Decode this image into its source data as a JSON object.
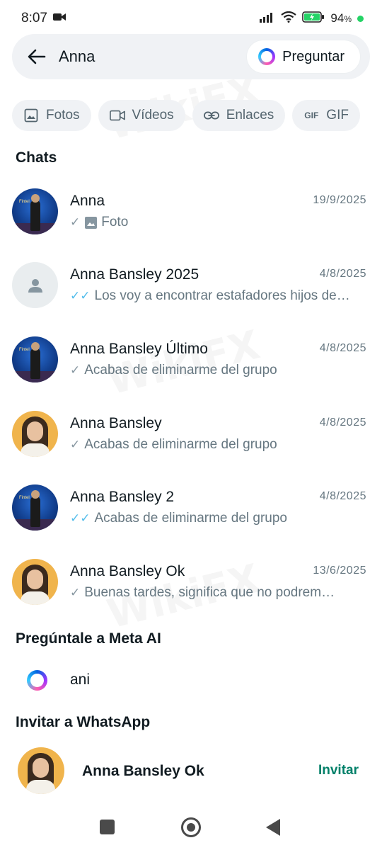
{
  "status_bar": {
    "time": "8:07",
    "battery": "94",
    "battery_unit": "%"
  },
  "search": {
    "query": "Anna",
    "ask_label": "Preguntar"
  },
  "filters": [
    {
      "label": "Fotos",
      "icon": "image-icon"
    },
    {
      "label": "Vídeos",
      "icon": "video-icon"
    },
    {
      "label": "Enlaces",
      "icon": "link-icon"
    },
    {
      "label": "GIF",
      "icon": "gif-icon"
    }
  ],
  "sections": {
    "chats": "Chats",
    "meta_ai": "Pregúntale a Meta AI",
    "invite": "Invitar a WhatsApp"
  },
  "chats": [
    {
      "name": "Anna",
      "date": "19/9/2025",
      "preview": "Foto",
      "tick": "✓",
      "status": "sent",
      "avatar": "stage"
    },
    {
      "name": "Anna Bansley 2025",
      "date": "4/8/2025",
      "preview": "Los voy a encontrar estafadores hijos de…",
      "tick": "✓✓",
      "status": "read",
      "avatar": "default"
    },
    {
      "name": "Anna Bansley Último",
      "date": "4/8/2025",
      "preview": "Acabas de eliminarme del grupo",
      "tick": "✓",
      "status": "sent",
      "avatar": "stage"
    },
    {
      "name": "Anna Bansley",
      "date": "4/8/2025",
      "preview": "Acabas de eliminarme del grupo",
      "tick": "✓",
      "status": "sent",
      "avatar": "portrait"
    },
    {
      "name": "Anna Bansley 2",
      "date": "4/8/2025",
      "preview": "Acabas de eliminarme del grupo",
      "tick": "✓✓",
      "status": "read",
      "avatar": "stage"
    },
    {
      "name": "Anna Bansley Ok",
      "date": "13/6/2025",
      "preview": "Buenas tardes, significa que no podrem…",
      "tick": "✓",
      "status": "sent",
      "avatar": "portrait"
    }
  ],
  "meta_ai": {
    "query": "ani"
  },
  "invite": {
    "name": "Anna Bansley Ok",
    "button": "Invitar"
  },
  "watermark": "WikiFX",
  "colors": {
    "accent_green": "#008069",
    "read_tick": "#53bdeb",
    "secondary_text": "#667781",
    "chip_bg": "#f0f2f5"
  }
}
